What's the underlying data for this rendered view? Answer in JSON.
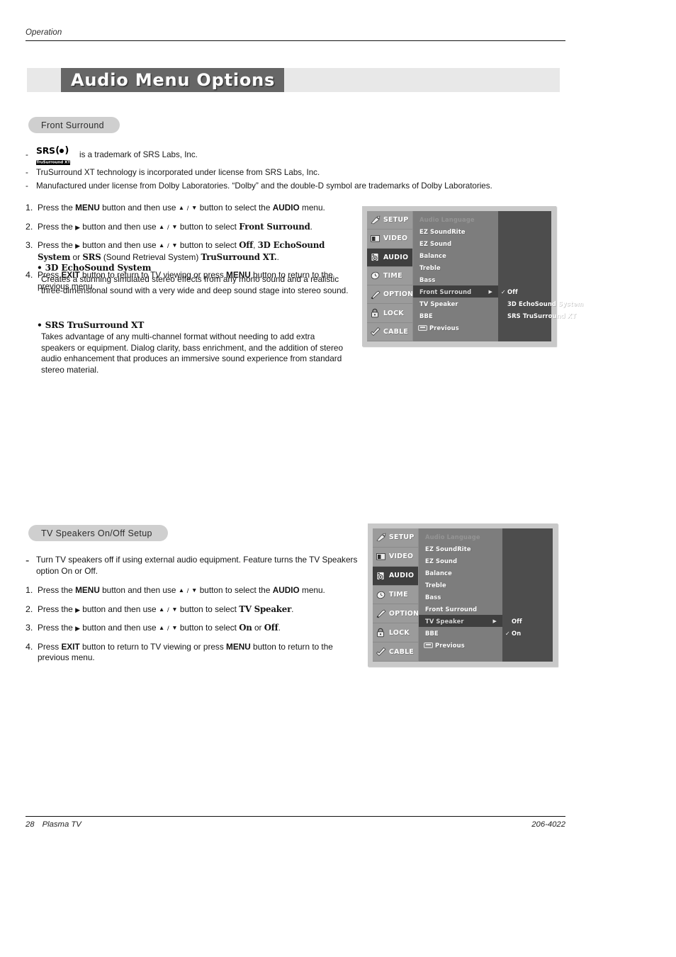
{
  "header": {
    "running_head": "Operation"
  },
  "title": {
    "text": "Audio Menu Options"
  },
  "sections": {
    "front_surround": {
      "pill": "Front Surround",
      "trademarks": [
        {
          "logo": "srs-trusurround-xt-logo",
          "text": "is a trademark of SRS Labs, Inc."
        },
        {
          "logo": null,
          "text": "TruSurround XT technology is incorporated under license from SRS Labs, Inc."
        },
        {
          "logo": null,
          "text": "Manufactured under license from Dolby Laboratories. “Dolby” and the double-D symbol are trademarks of Dolby Laboratories."
        }
      ],
      "srs_logo": {
        "top": "SRS",
        "bottom": "TruSurround XT"
      },
      "steps": [
        {
          "num": "1.",
          "parts": [
            {
              "t": "Press the "
            },
            {
              "t": "MENU",
              "s": "b"
            },
            {
              "t": " button and then use "
            },
            {
              "t": "",
              "s": "up"
            },
            {
              "t": " / ",
              "s": "slash"
            },
            {
              "t": "",
              "s": "dn"
            },
            {
              "t": " button to select the "
            },
            {
              "t": "AUDIO",
              "s": "b"
            },
            {
              "t": " menu."
            }
          ]
        },
        {
          "num": "2.",
          "parts": [
            {
              "t": "Press the "
            },
            {
              "t": "",
              "s": "rt"
            },
            {
              "t": "  button and then use "
            },
            {
              "t": "",
              "s": "up"
            },
            {
              "t": " / ",
              "s": "slash"
            },
            {
              "t": "",
              "s": "dn"
            },
            {
              "t": " button to select "
            },
            {
              "t": "Front Surround",
              "s": "bser"
            },
            {
              "t": "."
            }
          ]
        },
        {
          "num": "3.",
          "parts": [
            {
              "t": "Press the "
            },
            {
              "t": "",
              "s": "rt"
            },
            {
              "t": "  button and then use "
            },
            {
              "t": "",
              "s": "up"
            },
            {
              "t": " / ",
              "s": "slash"
            },
            {
              "t": "",
              "s": "dn"
            },
            {
              "t": " button to select "
            },
            {
              "t": "Off",
              "s": "bser"
            },
            {
              "t": ", "
            },
            {
              "t": "3D EchoSound System",
              "s": "bser"
            },
            {
              "t": " or "
            },
            {
              "t": "SRS",
              "s": "bser"
            },
            {
              "t": " (Sound Retrieval System) "
            },
            {
              "t": "TruSurround XT.",
              "s": "bser"
            },
            {
              "t": "."
            }
          ]
        },
        {
          "num": "4.",
          "parts": [
            {
              "t": "Press "
            },
            {
              "t": "EXIT",
              "s": "b"
            },
            {
              "t": " button to return to TV viewing or press "
            },
            {
              "t": "MENU",
              "s": "b"
            },
            {
              "t": " button to return to the previous menu."
            }
          ]
        }
      ],
      "features": [
        {
          "title": "• 3D EchoSound System",
          "text": "Creates a stunning simulated stereo effects from any mono sound and a realistic three-dimensional sound with a very wide and deep sound stage into stereo sound."
        },
        {
          "title": "• SRS TruSurround XT",
          "text": "Takes advantage of any multi-channel format without needing to add extra speakers or equipment. Dialog clarity, bass enrichment, and the addition of stereo audio enhancement that produces an immersive sound experience from standard stereo material."
        }
      ]
    },
    "tv_speakers": {
      "pill": "TV Speakers On/Off Setup",
      "note": "Turn TV speakers off if using external audio equipment. Feature turns the TV Speakers option On or Off.",
      "steps": [
        {
          "num": "1.",
          "parts": [
            {
              "t": "Press the "
            },
            {
              "t": "MENU",
              "s": "b"
            },
            {
              "t": " button and then use "
            },
            {
              "t": "",
              "s": "up"
            },
            {
              "t": " / ",
              "s": "slash"
            },
            {
              "t": "",
              "s": "dn"
            },
            {
              "t": " button to select the "
            },
            {
              "t": "AUDIO",
              "s": "b"
            },
            {
              "t": " menu."
            }
          ]
        },
        {
          "num": "2.",
          "parts": [
            {
              "t": "Press the "
            },
            {
              "t": "",
              "s": "rt"
            },
            {
              "t": " button and then use "
            },
            {
              "t": "",
              "s": "up"
            },
            {
              "t": " / ",
              "s": "slash"
            },
            {
              "t": "",
              "s": "dn"
            },
            {
              "t": " button to select "
            },
            {
              "t": "TV Speaker",
              "s": "bser"
            },
            {
              "t": "."
            }
          ]
        },
        {
          "num": "3.",
          "parts": [
            {
              "t": "Press the "
            },
            {
              "t": "",
              "s": "rt"
            },
            {
              "t": "  button and then use "
            },
            {
              "t": "",
              "s": "up"
            },
            {
              "t": " / ",
              "s": "slash"
            },
            {
              "t": "",
              "s": "dn"
            },
            {
              "t": " button to select "
            },
            {
              "t": "On",
              "s": "bser"
            },
            {
              "t": " or "
            },
            {
              "t": "Off",
              "s": "bser"
            },
            {
              "t": "."
            }
          ]
        },
        {
          "num": "4.",
          "parts": [
            {
              "t": "Press "
            },
            {
              "t": "EXIT",
              "s": "b"
            },
            {
              "t": " button to return to TV viewing or press "
            },
            {
              "t": "MENU",
              "s": "b"
            },
            {
              "t": " button to return to the previous menu."
            }
          ]
        }
      ]
    }
  },
  "osd": {
    "sidebar": [
      {
        "label": "SETUP",
        "icon": "satellite-dish-icon",
        "selected": false
      },
      {
        "label": "VIDEO",
        "icon": "monitor-icon",
        "selected": false
      },
      {
        "label": "AUDIO",
        "icon": "speaker-icon",
        "selected": true
      },
      {
        "label": "TIME",
        "icon": "clock-icon",
        "selected": false
      },
      {
        "label": "OPTION",
        "icon": "wrench-icon",
        "selected": false
      },
      {
        "label": "LOCK",
        "icon": "padlock-icon",
        "selected": false
      },
      {
        "label": "CABLE",
        "icon": "plug-icon",
        "selected": false
      }
    ],
    "screen_1": {
      "menu": [
        {
          "label": "Audio Language",
          "state": "dim"
        },
        {
          "label": "EZ SoundRite",
          "state": "normal"
        },
        {
          "label": "EZ Sound",
          "state": "normal"
        },
        {
          "label": "Balance",
          "state": "normal"
        },
        {
          "label": "Treble",
          "state": "normal"
        },
        {
          "label": "Bass",
          "state": "normal"
        },
        {
          "label": "Front Surround",
          "state": "selected",
          "arrow": "▶"
        },
        {
          "label": "TV Speaker",
          "state": "normal"
        },
        {
          "label": "BBE",
          "state": "normal"
        },
        {
          "label": "Previous",
          "state": "previous"
        }
      ],
      "options": [
        {
          "label": "Off",
          "checked": true
        },
        {
          "label": "3D EchoSound System",
          "checked": false
        },
        {
          "label": "SRS TruSurround XT",
          "checked": false
        }
      ]
    },
    "screen_2": {
      "menu": [
        {
          "label": "Audio Language",
          "state": "dim"
        },
        {
          "label": "EZ SoundRite",
          "state": "normal"
        },
        {
          "label": "EZ Sound",
          "state": "normal"
        },
        {
          "label": "Balance",
          "state": "normal"
        },
        {
          "label": "Treble",
          "state": "normal"
        },
        {
          "label": "Bass",
          "state": "normal"
        },
        {
          "label": "Front Surround",
          "state": "normal"
        },
        {
          "label": "TV Speaker",
          "state": "selected",
          "arrow": "▶"
        },
        {
          "label": "BBE",
          "state": "normal"
        },
        {
          "label": "Previous",
          "state": "previous"
        }
      ],
      "options": [
        {
          "label": "Off",
          "checked": false
        },
        {
          "label": "On",
          "checked": true
        }
      ]
    }
  },
  "footer": {
    "page_number": "28",
    "product": "Plasma TV",
    "doc_code": "206-4022"
  }
}
